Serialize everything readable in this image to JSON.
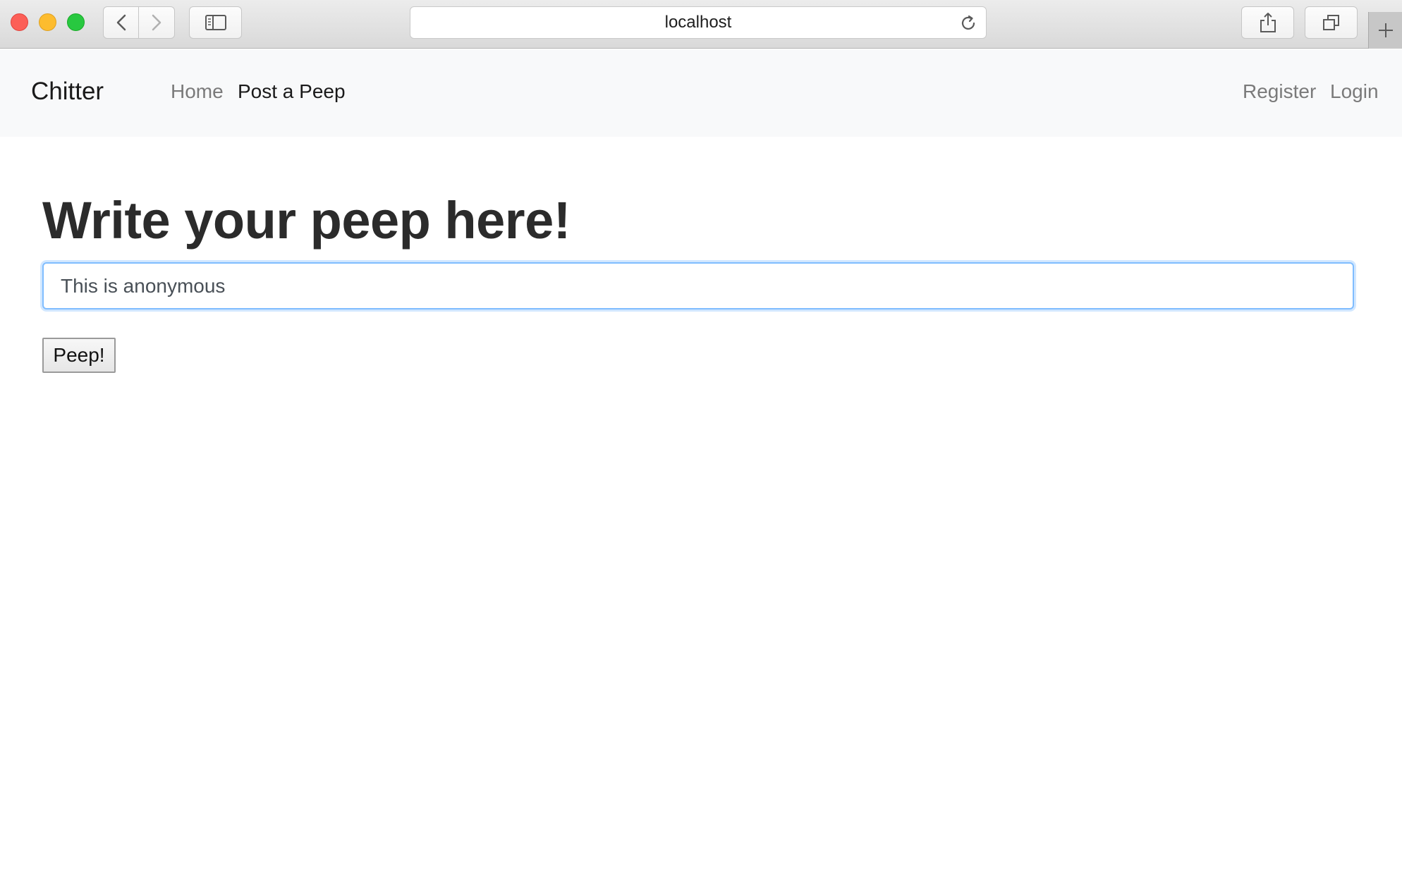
{
  "browser": {
    "address": "localhost"
  },
  "navbar": {
    "brand": "Chitter",
    "links": [
      {
        "label": "Home",
        "active": false
      },
      {
        "label": "Post a Peep",
        "active": true
      }
    ],
    "right_links": [
      {
        "label": "Register"
      },
      {
        "label": "Login"
      }
    ]
  },
  "main": {
    "title": "Write your peep here!",
    "peep_input": {
      "value": "This is anonymous",
      "placeholder": ""
    },
    "submit_label": "Peep!"
  },
  "colors": {
    "navbar_bg": "#f8f9fa",
    "input_focus": "#80bdff",
    "active_link": "#1a1a1a",
    "inactive_link": "#7a7a7a"
  },
  "icons": [
    "chevron-left-icon",
    "chevron-right-icon",
    "sidebar-icon",
    "reload-icon",
    "share-icon",
    "tabs-icon",
    "plus-icon"
  ]
}
